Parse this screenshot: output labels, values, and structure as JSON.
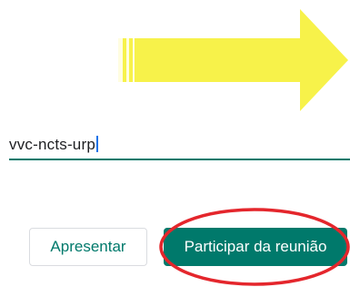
{
  "meeting": {
    "code_value": "vvc-ncts-urp"
  },
  "actions": {
    "present_label": "Apresentar",
    "join_label": "Participar da reunião"
  },
  "annotations": {
    "arrow_color": "#f7f24a",
    "arrow_stripe_color": "#fffde0",
    "circle_color": "#e4262c",
    "arrow_icon": "arrow-right-icon"
  },
  "colors": {
    "accent": "#00796b",
    "caret": "#1a73e8",
    "text": "#202124"
  }
}
